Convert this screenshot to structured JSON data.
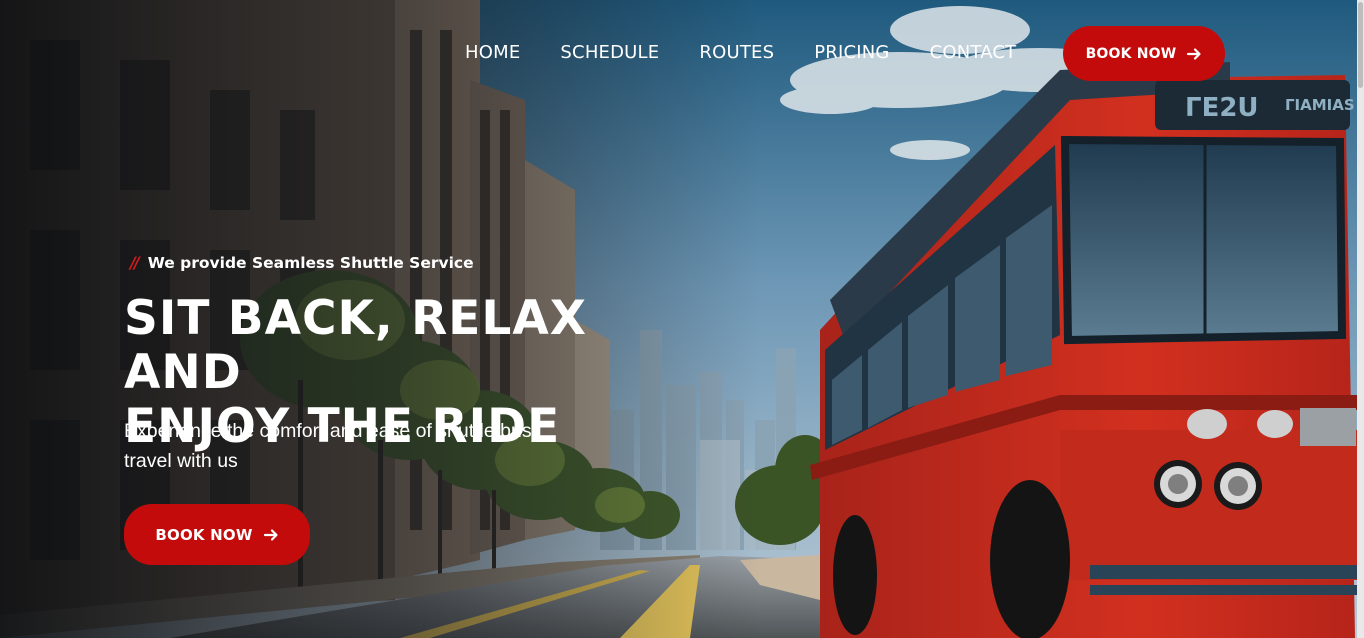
{
  "nav": {
    "items": [
      {
        "label": "HOME"
      },
      {
        "label": "SCHEDULE"
      },
      {
        "label": "ROUTES"
      },
      {
        "label": "PRICING"
      },
      {
        "label": "CONTACT"
      }
    ],
    "cta_label": "BOOK NOW",
    "cta_icon": "arrow-right-icon"
  },
  "hero": {
    "tagline_mark": "//",
    "tagline": "We provide Seamless Shuttle Service",
    "headline_line1": "SIT BACK, RELAX AND",
    "headline_line2": "ENJOY THE RIDE",
    "subtitle": "Experience the comfort and ease of shuttle bus travel with us",
    "cta_label": "BOOK NOW",
    "cta_icon": "arrow-right-icon"
  },
  "bus_sign": {
    "route": "ΓΕ2U",
    "destination": "ΓΙΑΜΙΑS"
  },
  "colors": {
    "accent": "#c30b0b",
    "text": "#ffffff",
    "sky": "#6f97b6",
    "bus_red": "#c8281b"
  }
}
